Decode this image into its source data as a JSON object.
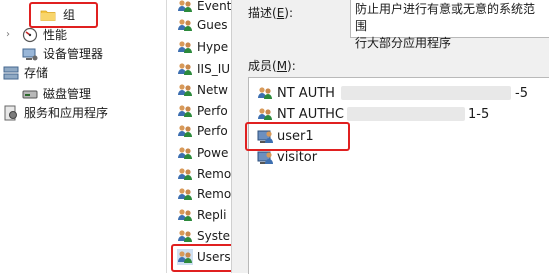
{
  "tree": {
    "items": [
      {
        "label": "组",
        "icon": "folder-icon"
      },
      {
        "label": "性能",
        "icon": "performance-icon",
        "expander": "›"
      },
      {
        "label": "设备管理器",
        "icon": "device-manager-icon"
      },
      {
        "label": "存储",
        "icon": "storage-icon"
      },
      {
        "label": "磁盘管理",
        "icon": "disk-management-icon"
      },
      {
        "label": "服务和应用程序",
        "icon": "services-icon"
      }
    ]
  },
  "group_list": {
    "items": [
      "Event",
      "Gues",
      "Hype",
      "IIS_IU",
      "Netw",
      "Perfo",
      "Perfo",
      "Powe",
      "Remo",
      "Remo",
      "Repli",
      "Syste",
      "Users"
    ]
  },
  "properties": {
    "description_label": "描述(",
    "description_key": "E",
    "description_suffix": "):",
    "description_value_line1": "防止用户进行有意或无意的系统范围",
    "description_value_line2": "行大部分应用程序",
    "members_label": "成员(",
    "members_key": "M",
    "members_suffix": "):",
    "members": [
      {
        "name_start": "NT AUTH",
        "name_end": "-5",
        "icon": "group-users-icon"
      },
      {
        "name_start": "NT AUTHC",
        "name_end": "1-5",
        "icon": "group-users-icon"
      },
      {
        "name_start": "user1",
        "name_end": "",
        "icon": "user-icon"
      },
      {
        "name_start": "visitor",
        "name_end": "",
        "icon": "user-icon"
      }
    ]
  },
  "colors": {
    "highlight": "#e02020",
    "pane_bg": "#f0f0f0",
    "folder": "#f5c542"
  }
}
